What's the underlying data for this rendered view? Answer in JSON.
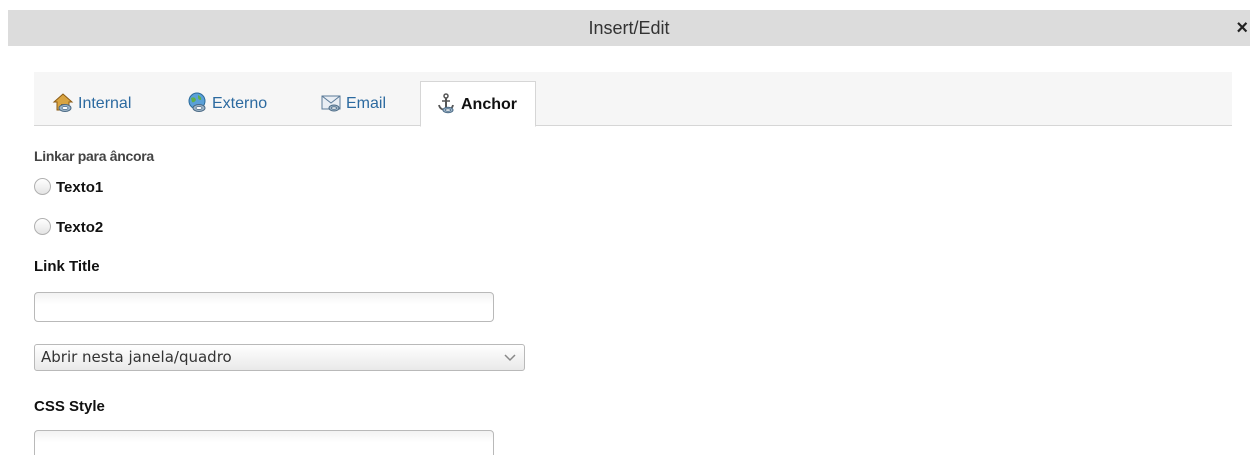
{
  "dialog": {
    "title": "Insert/Edit",
    "close_label": "×"
  },
  "tabs": [
    {
      "label": "Internal",
      "icon": "house-link-icon",
      "active": false
    },
    {
      "label": "Externo",
      "icon": "globe-link-icon",
      "active": false
    },
    {
      "label": "Email",
      "icon": "envelope-icon",
      "active": false
    },
    {
      "label": "Anchor",
      "icon": "anchor-icon",
      "active": true
    }
  ],
  "anchor": {
    "section_label": "Linkar para âncora",
    "options": [
      {
        "label": "Texto1",
        "checked": false
      },
      {
        "label": "Texto2",
        "checked": false
      }
    ]
  },
  "link_title": {
    "label": "Link Title",
    "value": ""
  },
  "target_select": {
    "selected": "Abrir nesta janela/quadro"
  },
  "css_style": {
    "label": "CSS Style",
    "value": ""
  },
  "colors": {
    "titlebar_bg": "#dcdcdc",
    "tab_link": "#2c6aa0",
    "tab_strip_bg": "#f6f6f6"
  }
}
